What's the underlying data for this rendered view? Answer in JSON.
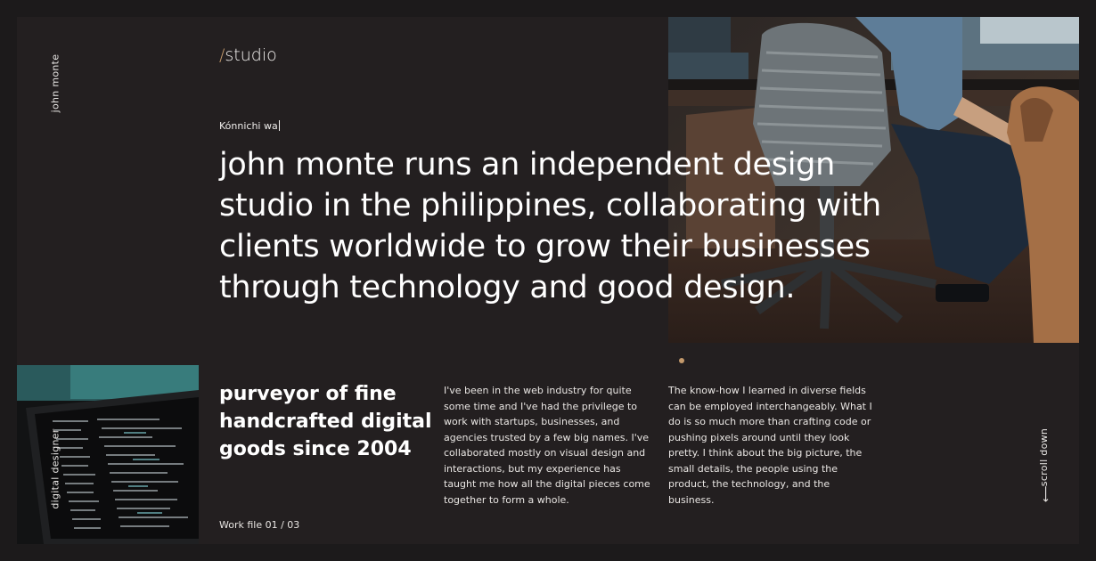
{
  "site": {
    "owner_name": "john monte",
    "logo": {
      "slash": "/",
      "word": "studio"
    }
  },
  "hero": {
    "greeting": "Kónnichi wa",
    "headline": "john monte runs an independent design studio in the philippines, collaborating with clients worldwide to grow their businesses through technology and good design."
  },
  "about": {
    "role_label": "digital designer",
    "tagline": "purveyor of fine handcrafted digital goods since 2004",
    "paragraph_1": "I've been in the web industry for quite some time and I've had the privilege to work with startups, businesses, and agencies trusted by a few big names. I've collaborated mostly on visual design and interactions, but my experience has taught me how all the digital pieces come together to form a whole.",
    "paragraph_2": "The know-how I learned in diverse fields can be employed interchangeably. What I do is so much more than crafting code or pushing pixels around until they look pretty. I think about the big picture, the small details, the people using the product, the technology, and the business.",
    "work_file": "Work file 01 / 03"
  },
  "scroll": {
    "label": "scroll down",
    "arrow": "⟶"
  },
  "colors": {
    "background": "#231f20",
    "outer": "#1c1a1b",
    "accent": "#c49a6c",
    "text": "#ffffff"
  },
  "icons": [
    "office-photo",
    "laptop-code-photo",
    "carousel-dot",
    "arrow-down-icon"
  ]
}
